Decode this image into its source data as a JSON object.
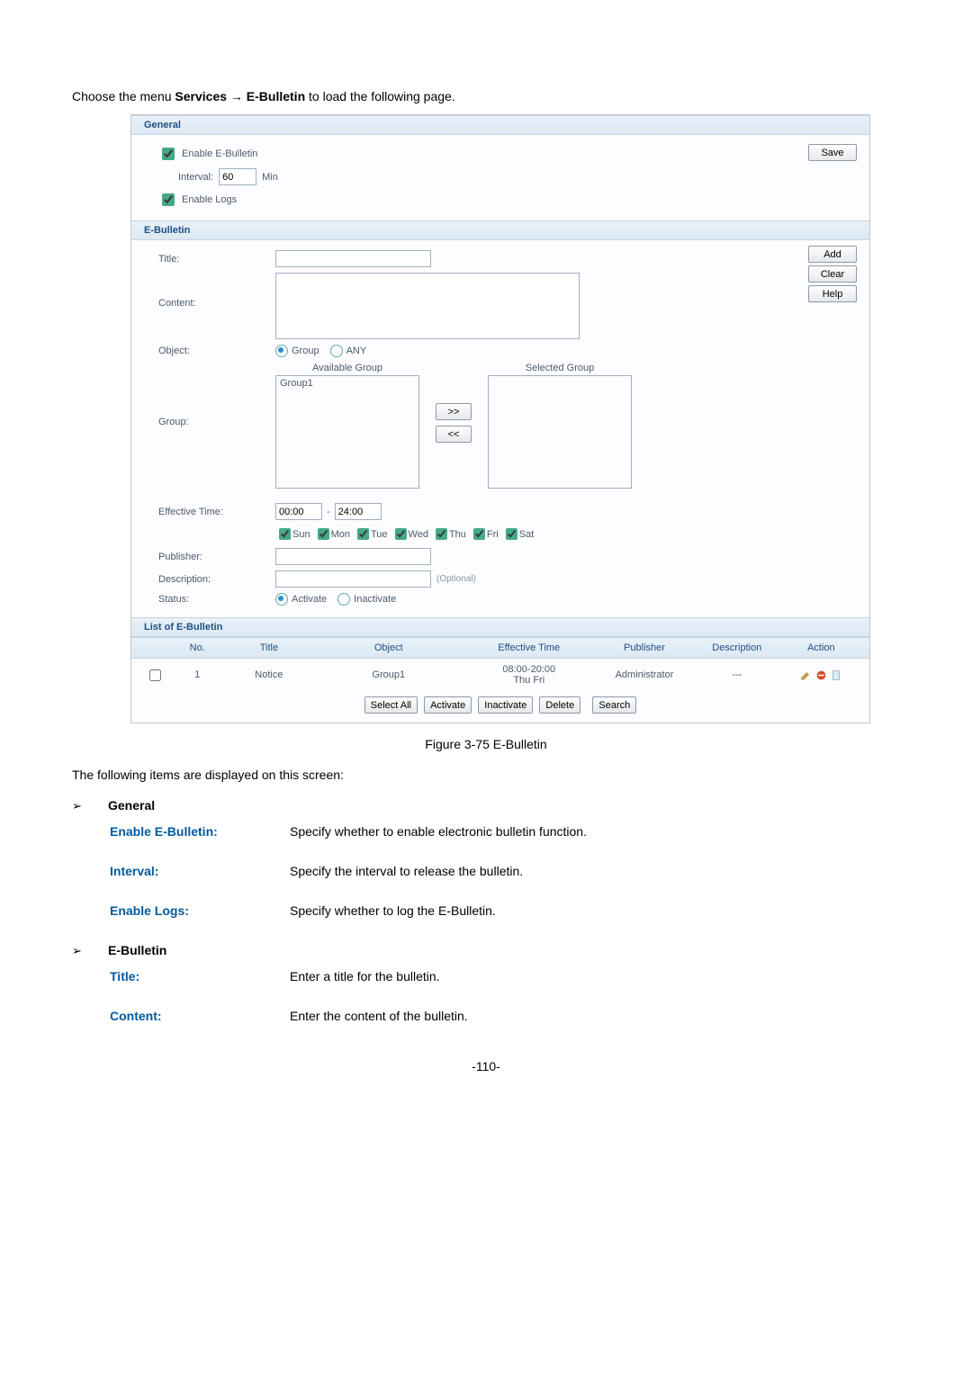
{
  "instruction": {
    "prefix": "Choose the menu ",
    "path1": "Services",
    "arrow": "→",
    "path2": "E-Bulletin",
    "suffix": " to load the following page."
  },
  "ui": {
    "general": {
      "header": "General",
      "enable_label": "Enable E-Bulletin",
      "interval_label": "Interval:",
      "interval_value": "60",
      "interval_unit": "Min",
      "logs_label": "Enable Logs",
      "save_btn": "Save"
    },
    "bulletin": {
      "header": "E-Bulletin",
      "title_label": "Title:",
      "content_label": "Content:",
      "add_btn": "Add",
      "clear_btn": "Clear",
      "help_btn": "Help",
      "object_label": "Object:",
      "object_opt_group": "Group",
      "object_opt_any": "ANY",
      "group_label": "Group:",
      "available_head": "Available Group",
      "available_item": "Group1",
      "selected_head": "Selected Group",
      "move_right": ">>",
      "move_left": "<<",
      "eff_label": "Effective Time:",
      "eff_start": "00:00",
      "eff_sep": "-",
      "eff_end": "24:00",
      "days": {
        "sun": "Sun",
        "mon": "Mon",
        "tue": "Tue",
        "wed": "Wed",
        "thu": "Thu",
        "fri": "Fri",
        "sat": "Sat"
      },
      "publisher_label": "Publisher:",
      "description_label": "Description:",
      "optional": "(Optional)",
      "status_label": "Status:",
      "status_activate": "Activate",
      "status_inactivate": "Inactivate"
    },
    "list": {
      "header": "List of E-Bulletin",
      "cols": {
        "no": "No.",
        "title": "Title",
        "object": "Object",
        "eff": "Effective Time",
        "pub": "Publisher",
        "desc": "Description",
        "action": "Action"
      },
      "row": {
        "no": "1",
        "title": "Notice",
        "object": "Group1",
        "eff": "08:00-20:00\nThu Fri",
        "pub": "Administrator",
        "desc": "---"
      },
      "bulk": {
        "select_all": "Select All",
        "activate": "Activate",
        "inactivate": "Inactivate",
        "delete": "Delete",
        "search": "Search"
      }
    }
  },
  "caption": "Figure 3-75 E-Bulletin",
  "items_intro": "The following items are displayed on this screen:",
  "sections": [
    {
      "heading": "General",
      "defs": [
        {
          "term": "Enable E-Bulletin:",
          "desc": "Specify whether to enable electronic bulletin function."
        },
        {
          "term": "Interval:",
          "desc": "Specify the interval to release the bulletin."
        },
        {
          "term": "Enable Logs:",
          "desc": "Specify whether to log the E-Bulletin."
        }
      ]
    },
    {
      "heading": "E-Bulletin",
      "defs": [
        {
          "term": "Title:",
          "desc": "Enter a title for the bulletin."
        },
        {
          "term": "Content:",
          "desc": "Enter the content of the bulletin."
        }
      ]
    }
  ],
  "page_num": "-110-"
}
